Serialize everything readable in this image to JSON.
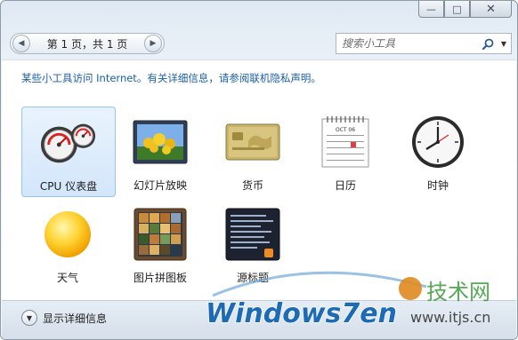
{
  "window": {
    "minimize_icon": "minimize-icon",
    "maximize_icon": "maximize-icon",
    "close_icon": "close-icon"
  },
  "toolbar": {
    "page_text": "第 1 页，共 1 页",
    "search_placeholder": "搜索小工具"
  },
  "notice": "某些小工具访问 Internet。有关详细信息，请参阅联机隐私声明。",
  "gadgets": [
    {
      "label": "CPU 仪表盘",
      "icon": "cpu-meter-icon",
      "selected": true
    },
    {
      "label": "幻灯片放映",
      "icon": "slideshow-icon",
      "selected": false
    },
    {
      "label": "货币",
      "icon": "currency-icon",
      "selected": false
    },
    {
      "label": "日历",
      "icon": "calendar-icon",
      "selected": false
    },
    {
      "label": "时钟",
      "icon": "clock-icon",
      "selected": false
    },
    {
      "label": "天气",
      "icon": "weather-icon",
      "selected": false
    },
    {
      "label": "图片拼图板",
      "icon": "picture-puzzle-icon",
      "selected": false
    },
    {
      "label": "源标题",
      "icon": "feed-headlines-icon",
      "selected": false
    }
  ],
  "calendar_icon_month": "OCT 06",
  "footer": {
    "details_label": "显示详细信息"
  },
  "watermark": {
    "logo_text": "Windows7en",
    "site_name": "技术网",
    "url": "www.itjs.cn"
  },
  "colors": {
    "link": "#1a5ea8",
    "selection": "#d3e6fb",
    "frame": "#dfe9f3"
  }
}
